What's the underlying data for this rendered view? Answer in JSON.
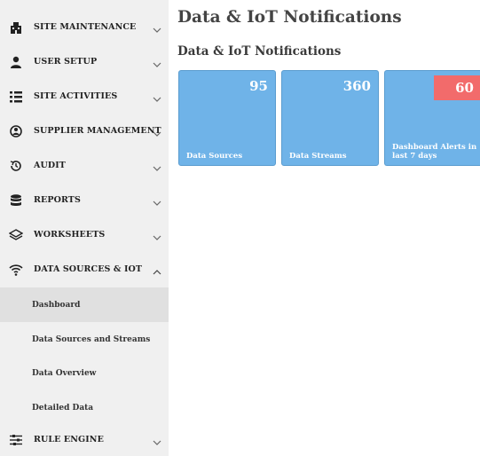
{
  "sidebar": {
    "items": [
      {
        "label": "SITE MAINTENANCE",
        "icon": "building-icon",
        "expanded": false
      },
      {
        "label": "USER SETUP",
        "icon": "user-icon",
        "expanded": false
      },
      {
        "label": "SITE ACTIVITIES",
        "icon": "list-icon",
        "expanded": false
      },
      {
        "label": "SUPPLIER MANAGEMENT",
        "icon": "supplier-icon",
        "expanded": false
      },
      {
        "label": "AUDIT",
        "icon": "history-icon",
        "expanded": false
      },
      {
        "label": "REPORTS",
        "icon": "database-icon",
        "expanded": false
      },
      {
        "label": "WORKSHEETS",
        "icon": "layers-icon",
        "expanded": false
      },
      {
        "label": "DATA SOURCES & IOT",
        "icon": "wifi-icon",
        "expanded": true
      },
      {
        "label": "RULE ENGINE",
        "icon": "sliders-icon",
        "expanded": false
      }
    ],
    "sub_items": [
      {
        "label": "Dashboard",
        "active": true
      },
      {
        "label": "Data Sources and Streams",
        "active": false
      },
      {
        "label": "Data Overview",
        "active": false
      },
      {
        "label": "Detailed Data",
        "active": false
      }
    ]
  },
  "main": {
    "page_title": "Data & IoT Notifications",
    "section_title": "Data & IoT Notifications",
    "cards": [
      {
        "value": "95",
        "label": "Data Sources",
        "alert": false
      },
      {
        "value": "360",
        "label": "Data Streams",
        "alert": false
      },
      {
        "value": "60",
        "label": "Dashboard Alerts in last 7 days",
        "alert": true
      }
    ]
  },
  "colors": {
    "card_blue": "#6fb3e8",
    "alert_red": "#f26b6b",
    "sidebar_bg": "#f0f0f0",
    "active_bg": "#e0e0e0"
  }
}
